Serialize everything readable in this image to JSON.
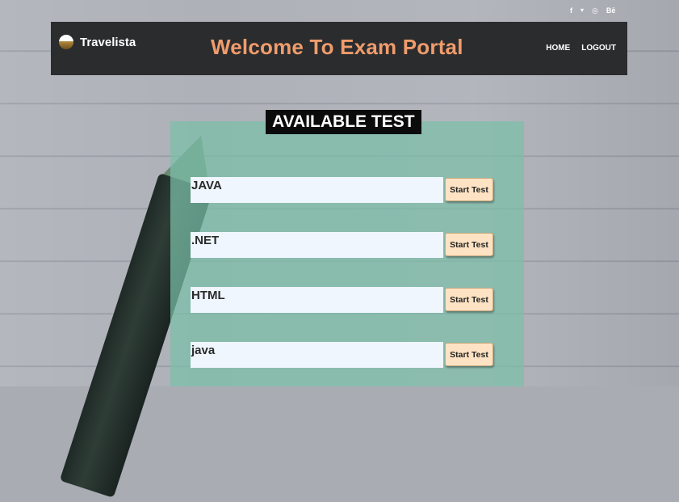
{
  "social": {
    "icons": [
      "facebook-icon",
      "twitter-icon",
      "dribbble-icon",
      "behance-icon"
    ],
    "glyphs": [
      "f",
      "🐦",
      "◎",
      "Bē"
    ]
  },
  "header": {
    "brand": "Travelista",
    "title": "Welcome To Exam Portal",
    "nav": [
      "HOME",
      "LOGOUT"
    ]
  },
  "main": {
    "heading": "AVAILABLE TEST",
    "tests": [
      {
        "name": "JAVA",
        "button": "Start Test"
      },
      {
        "name": ".NET",
        "button": "Start Test"
      },
      {
        "name": "HTML",
        "button": "Start Test"
      },
      {
        "name": "java",
        "button": "Start Test"
      }
    ]
  },
  "colors": {
    "navbar_bg": "#2b2c2e",
    "title_accent": "#f09c6c",
    "panel_bg": "#7cbfa9",
    "button_bg": "#fde3c3",
    "field_bg": "#eff6fd"
  }
}
